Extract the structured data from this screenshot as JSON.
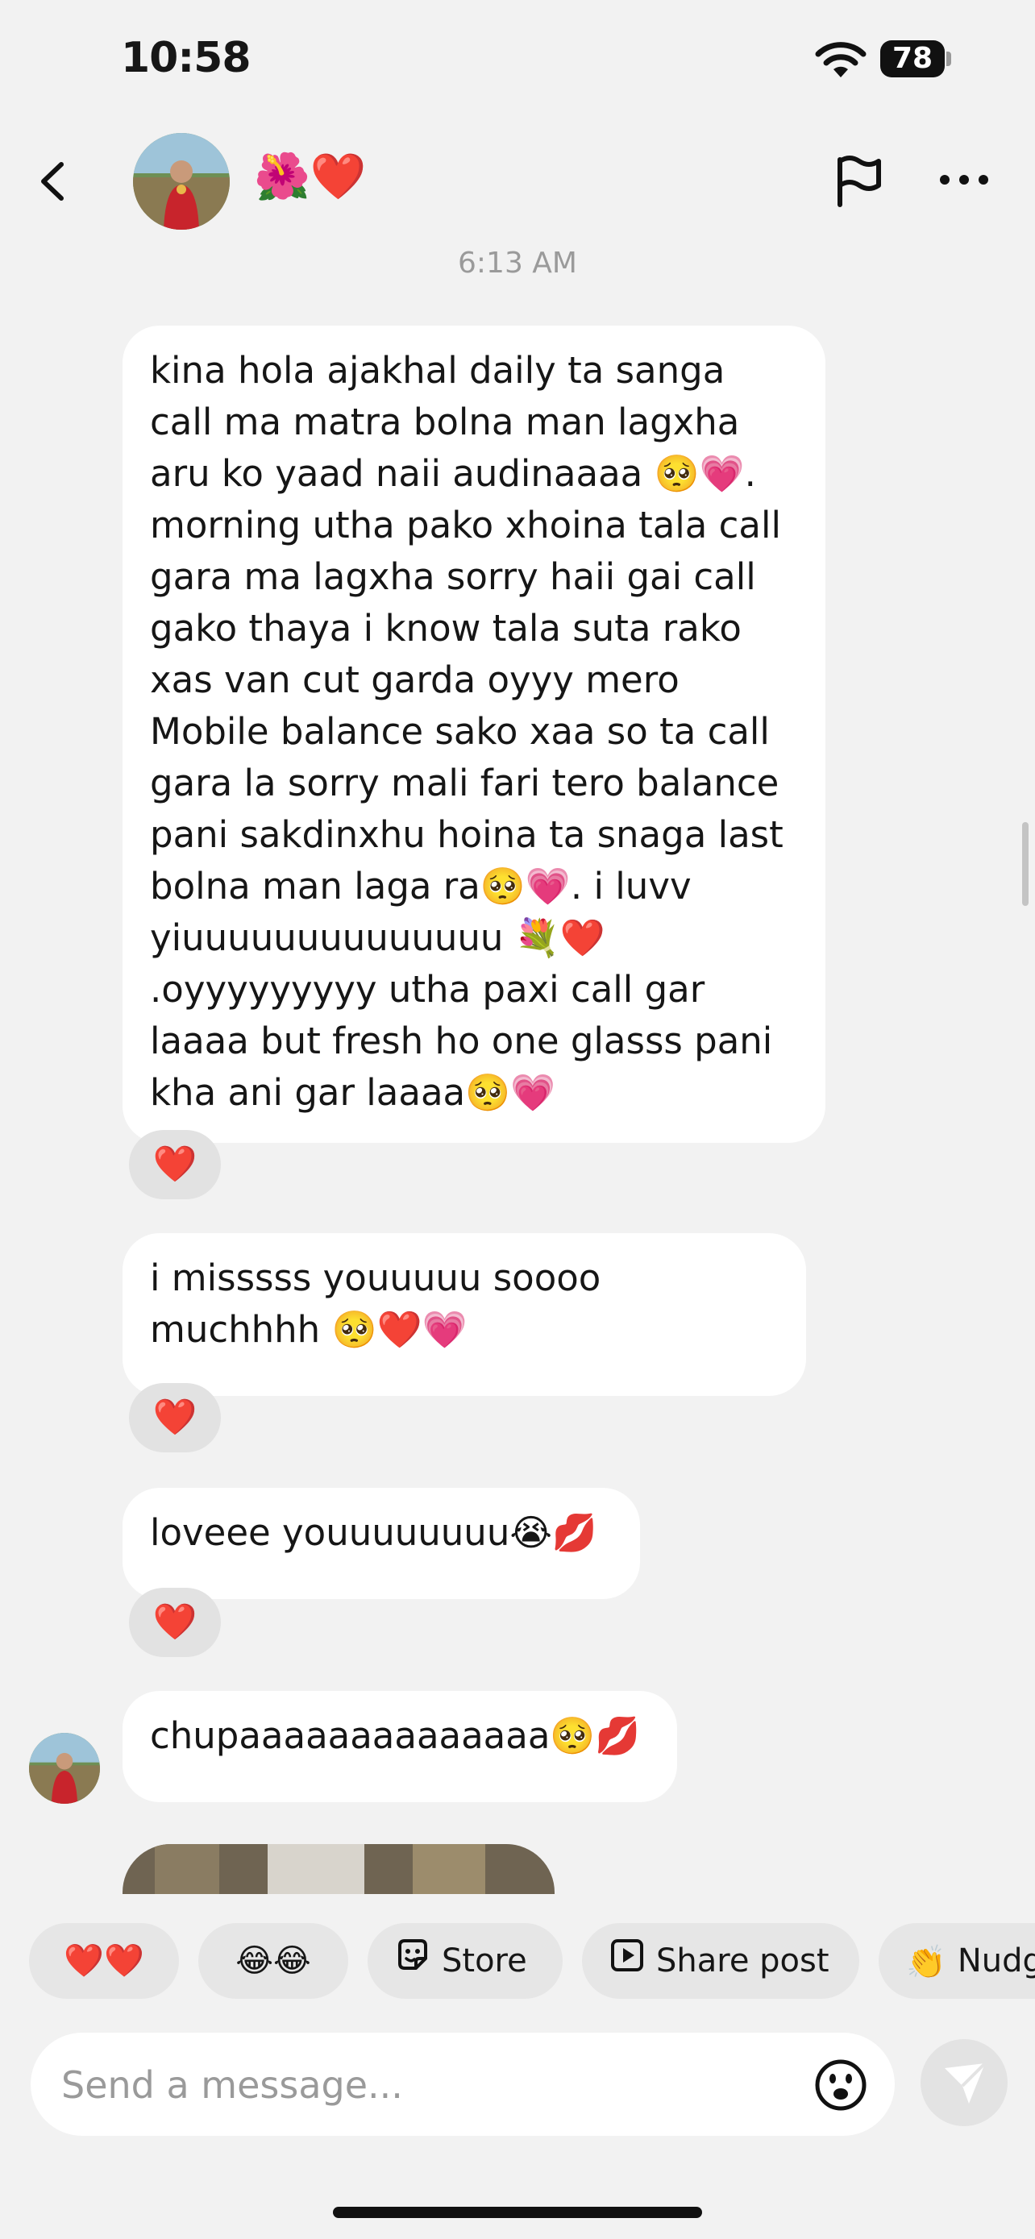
{
  "status_bar": {
    "time": "10:58",
    "battery": "78"
  },
  "header": {
    "contact_name": "🌺❤️"
  },
  "conversation": {
    "timestamp": "6:13 AM",
    "messages": [
      {
        "text": "kina hola ajakhal daily ta sanga call ma matra bolna man lagxha aru ko yaad naii audinaaaa 🥺💗. morning utha pako xhoina tala call gara ma lagxha sorry haii gai call gako thaya i know tala suta rako xas van cut garda oyyy mero Mobile balance sako xaa so ta call gara la sorry mali fari tero balance pani sakdinxhu hoina ta snaga last bolna man laga ra🥺💗. i luvv yiuuuuuuuuuuuuuu 💐❤️ .oyyyyyyyyy utha paxi call gar laaaa but fresh ho one glasss pani kha ani gar laaaa🥺💗",
        "reaction": "❤️"
      },
      {
        "text": "i misssss youuuuu soooo muchhhh 🥺❤️💗",
        "reaction": "❤️"
      },
      {
        "text": "loveee youuuuuuuu😭💋",
        "reaction": "❤️"
      },
      {
        "text": "chupaaaaaaaaaaaaaa🥺💋"
      }
    ]
  },
  "quick_replies": [
    "❤️❤️",
    "😂😂",
    "Store",
    "Share post",
    "Nudge"
  ],
  "composer": {
    "placeholder": "Send a message..."
  }
}
